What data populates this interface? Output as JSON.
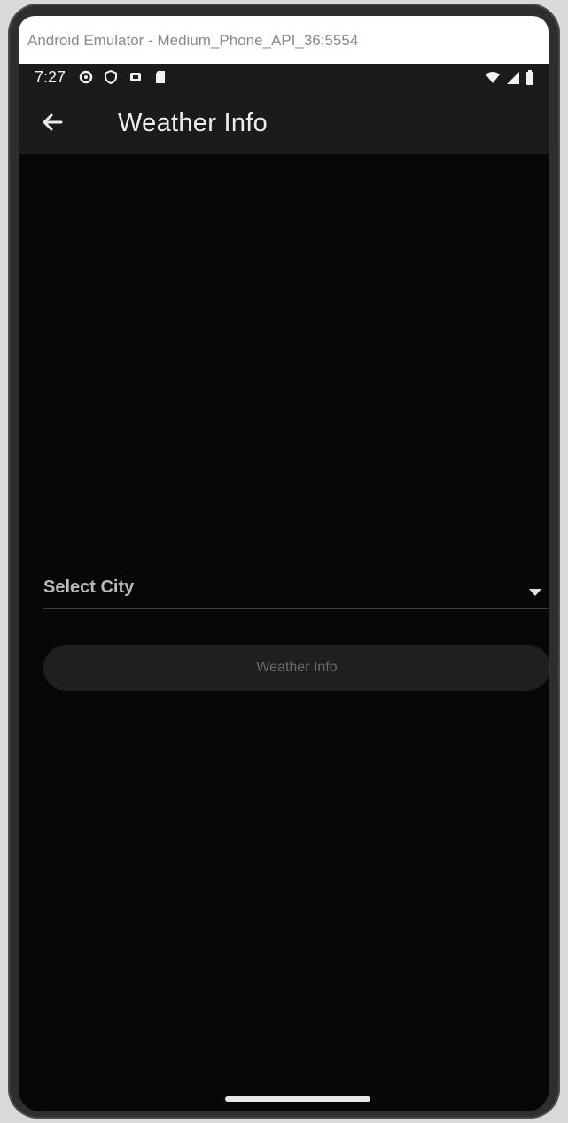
{
  "window": {
    "title": "Android Emulator - Medium_Phone_API_36:5554"
  },
  "status_bar": {
    "time": "7:27",
    "left_icons": [
      "settings-status-icon",
      "shield-icon",
      "notification-icon",
      "sd-card-icon"
    ],
    "right_icons": [
      "wifi-icon",
      "cellular-signal-icon",
      "battery-icon"
    ]
  },
  "app_bar": {
    "back_icon": "arrow-left-icon",
    "title": "Weather Info"
  },
  "form": {
    "city_dropdown": {
      "label": "Select City",
      "caret_icon": "caret-down-icon"
    },
    "submit_button": {
      "label": "Weather Info"
    }
  },
  "colors": {
    "background": "#070707",
    "app_bar": "#1b1b1b",
    "button_bg": "#1f1f1f",
    "button_text": "#6b6b6b",
    "label_text": "#b9b9b9"
  }
}
